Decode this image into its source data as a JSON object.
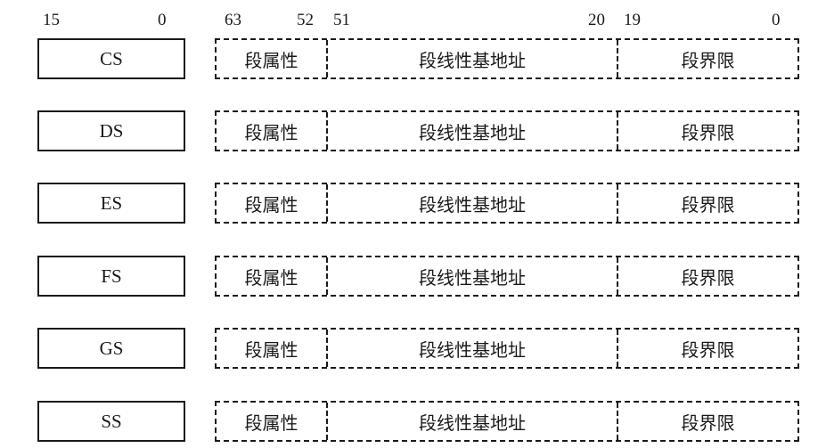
{
  "bit_labels": {
    "reg_high": "15",
    "reg_low": "0",
    "attr_high": "63",
    "attr_low": "52",
    "base_high": "51",
    "base_low": "20",
    "limit_high": "19",
    "limit_low": "0"
  },
  "fields": {
    "attribute": "段属性",
    "base": "段线性基地址",
    "limit": "段界限"
  },
  "registers": [
    {
      "name": "CS"
    },
    {
      "name": "DS"
    },
    {
      "name": "ES"
    },
    {
      "name": "FS"
    },
    {
      "name": "GS"
    },
    {
      "name": "SS"
    }
  ]
}
